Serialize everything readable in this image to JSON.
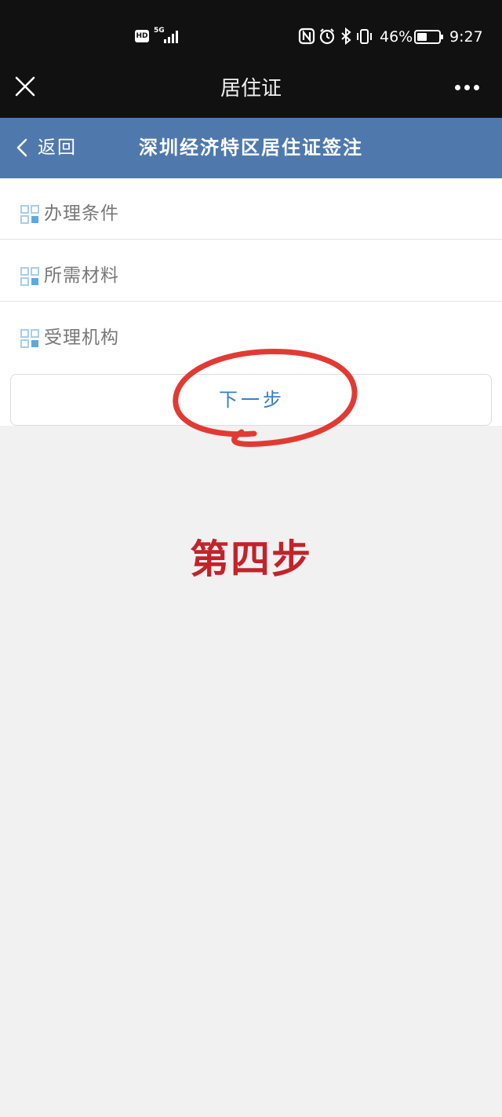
{
  "status_bar": {
    "hd_badge": "HD",
    "network": "5G",
    "battery_percent": "46%",
    "battery_level": 0.46,
    "time": "9:27",
    "icons": [
      "signal-icon",
      "nfc-icon",
      "alarm-icon",
      "bluetooth-icon",
      "vibrate-icon",
      "battery-icon"
    ]
  },
  "title_bar": {
    "title": "居住证",
    "close_icon": "close-icon",
    "more_icon": "more-icon"
  },
  "header": {
    "back_label": "返回",
    "title": "深圳经济特区居住证签注",
    "color": "#4f79ad"
  },
  "menu": {
    "items": [
      {
        "label": "办理条件",
        "icon": "grid-icon"
      },
      {
        "label": "所需材料",
        "icon": "grid-icon"
      },
      {
        "label": "受理机构",
        "icon": "grid-icon"
      }
    ],
    "icon_colors": [
      "#a9cdea",
      "#5aa9e6"
    ]
  },
  "next_button": {
    "label": "下一步",
    "color": "#3a7fc1"
  },
  "annotation": {
    "text": "第四步",
    "color": "#c4222a",
    "circle_color": "#e23a33"
  }
}
